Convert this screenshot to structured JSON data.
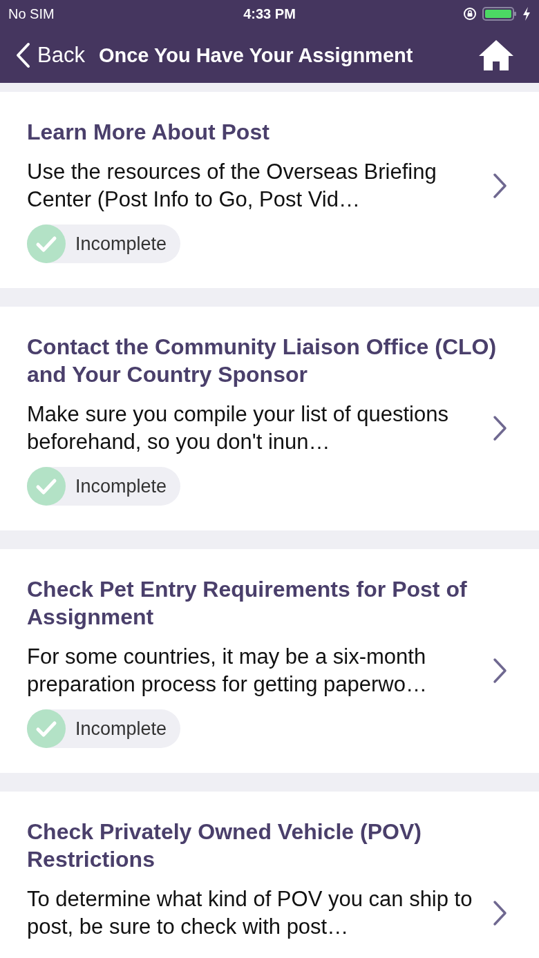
{
  "status_bar": {
    "carrier": "No SIM",
    "time": "4:33 PM",
    "charging": true
  },
  "nav_bar": {
    "back": "Back",
    "title": "Once You Have Your Assignment"
  },
  "items": [
    {
      "title": "Learn More About Post",
      "description": "Use the resources of the Overseas Briefing Center (Post Info to Go, Post Vid…",
      "status": "Incomplete",
      "completed": false
    },
    {
      "title": "Contact the Community Liaison Office (CLO) and Your Country Sponsor",
      "description": "Make sure you compile your list of questions beforehand, so you don't inun…",
      "status": "Incomplete",
      "completed": false
    },
    {
      "title": "Check Pet Entry Requirements for Post of Assignment",
      "description": "For some countries, it may be a six-month preparation process for getting paperwo…",
      "status": "Incomplete",
      "completed": false
    },
    {
      "title": "Check Privately Owned Vehicle (POV) Restrictions",
      "description": "To determine what kind of POV you can ship to post, be sure to check with post…"
    }
  ]
}
